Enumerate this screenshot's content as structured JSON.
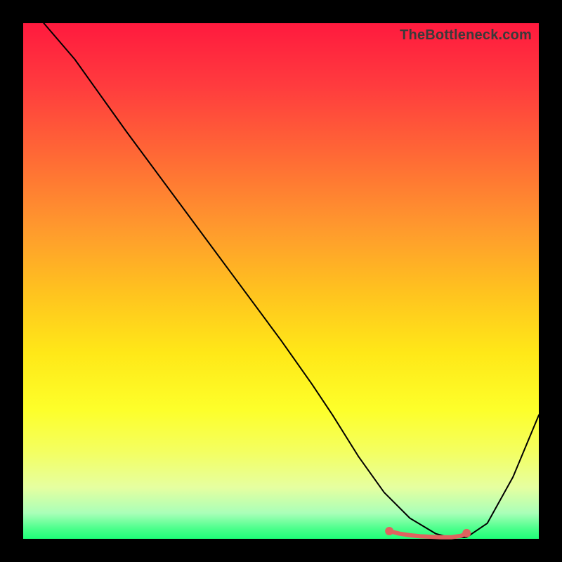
{
  "watermark": "TheBottleneck.com",
  "chart_data": {
    "type": "line",
    "title": "",
    "xlabel": "",
    "ylabel": "",
    "xlim": [
      0,
      100
    ],
    "ylim": [
      0,
      100
    ],
    "grid": false,
    "legend": false,
    "background_gradient": {
      "top": "#ff1a3e",
      "mid": "#ffe818",
      "bottom": "#1eff78"
    },
    "series": [
      {
        "name": "black-curve",
        "color": "#000000",
        "stroke_width": 2,
        "x": [
          4,
          10,
          20,
          30,
          40,
          50,
          56,
          60,
          65,
          70,
          75,
          80,
          83,
          86,
          90,
          95,
          100
        ],
        "values": [
          100,
          93,
          79,
          65.5,
          52,
          38.5,
          30,
          24,
          16,
          9,
          4,
          1,
          0.2,
          0.3,
          3,
          12,
          24
        ]
      },
      {
        "name": "red-highlight",
        "color": "#e0625f",
        "stroke_width": 6,
        "x": [
          71,
          73,
          75,
          77,
          79,
          81,
          83,
          85,
          86
        ],
        "values": [
          1.5,
          1.0,
          0.7,
          0.5,
          0.4,
          0.3,
          0.3,
          0.6,
          1.1
        ],
        "dots_x": [
          71,
          86
        ],
        "dots_y": [
          1.5,
          1.1
        ],
        "dot_radius": 6
      }
    ]
  }
}
